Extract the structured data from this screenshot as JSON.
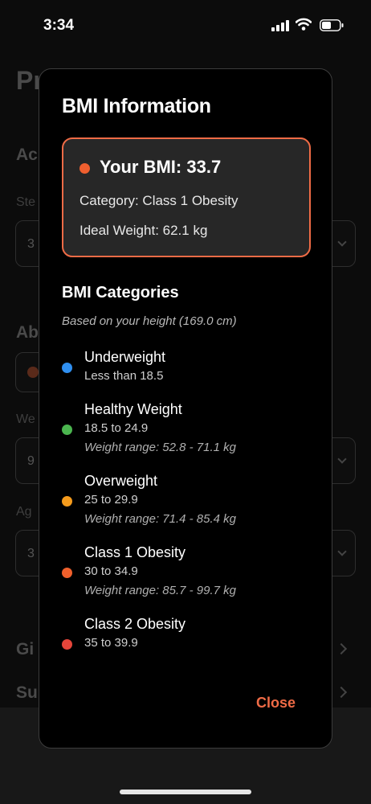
{
  "status_bar": {
    "time": "3:34"
  },
  "background": {
    "title_fragment": "Pr",
    "section1_fragment": "Ac",
    "label1_fragment": "Ste",
    "field1_fragment": "3",
    "section2_fragment": "Ab",
    "label2_fragment": "We",
    "field2_fragment": "9",
    "label3_fragment": "Ag",
    "field3_fragment": "3",
    "row1_fragment": "Gi",
    "row2_fragment": "Su"
  },
  "modal": {
    "title": "BMI Information",
    "bmi_card": {
      "heading": "Your BMI: 33.7",
      "category": "Category: Class 1 Obesity",
      "ideal_weight": "Ideal Weight: 62.1 kg",
      "accent_color": "#ef6b46"
    },
    "categories_title": "BMI Categories",
    "categories_subtitle": "Based on your height (169.0 cm)",
    "categories": [
      {
        "name": "Underweight",
        "range": "Less than 18.5",
        "weight_range": "",
        "color": "#2f8ff0"
      },
      {
        "name": "Healthy Weight",
        "range": "18.5 to 24.9",
        "weight_range": "Weight range: 52.8 - 71.1 kg",
        "color": "#4bb54f"
      },
      {
        "name": "Overweight",
        "range": "25 to 29.9",
        "weight_range": "Weight range: 71.4 - 85.4 kg",
        "color": "#f59b1c"
      },
      {
        "name": "Class 1 Obesity",
        "range": "30 to 34.9",
        "weight_range": "Weight range: 85.7 - 99.7 kg",
        "color": "#f0602c"
      },
      {
        "name": "Class 2 Obesity",
        "range": "35 to 39.9",
        "weight_range": "",
        "color": "#e5453a"
      }
    ],
    "close_label": "Close"
  }
}
